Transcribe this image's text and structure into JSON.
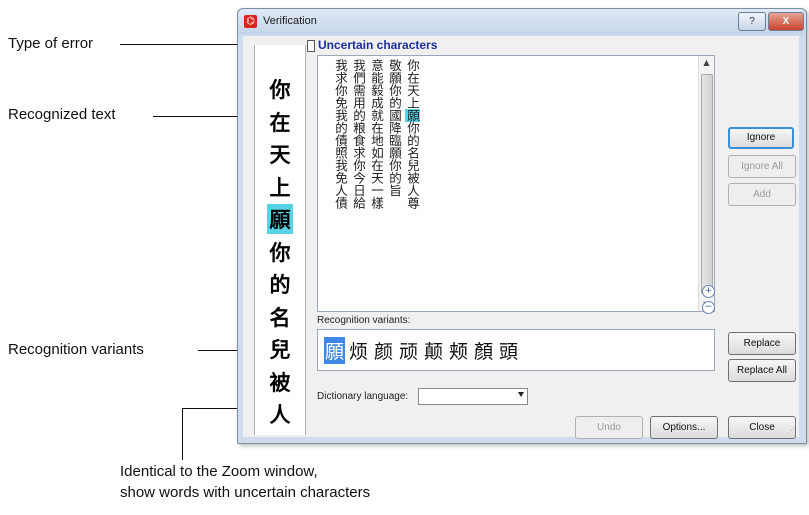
{
  "annotations": {
    "type_of_error": "Type of error",
    "recognized_text": "Recognized text",
    "recognition_variants": "Recognition variants",
    "zoom_line1": "Identical to the Zoom window,",
    "zoom_line2": "show words with uncertain characters"
  },
  "window": {
    "title": "Verification",
    "help_btn": "?",
    "close_btn": "X"
  },
  "zoom_window": {
    "chars": [
      "你",
      "在",
      "天",
      "上",
      "願",
      "你",
      "的",
      "名",
      "兒",
      "被",
      "人"
    ],
    "highlight_index": 4
  },
  "error_type": "Uncertain characters",
  "recognized_text": {
    "columns": [
      "你在天上願你的名兒被人尊",
      "敬願你的國降臨願你的旨",
      "意能毅成就在地如在天一樣",
      "我們需用的粮食求你今日給",
      "我求你免我的債照我免人債"
    ],
    "highlight": {
      "column": 0,
      "char_index": 4
    }
  },
  "recognition_variants": {
    "label": "Recognition variants:",
    "items": [
      "願",
      "烦",
      "颜",
      "顽",
      "颠",
      "颊",
      "顏",
      "頭"
    ],
    "selected_index": 0
  },
  "dictionary_language": {
    "label": "Dictionary language:",
    "value": ""
  },
  "buttons": {
    "ignore": "Ignore",
    "ignore_all": "Ignore All",
    "add": "Add",
    "replace": "Replace",
    "replace_all": "Replace All",
    "undo": "Undo",
    "options": "Options...",
    "close": "Close"
  },
  "zoom_controls": {
    "zoom_in": "+",
    "zoom_out": "−"
  }
}
